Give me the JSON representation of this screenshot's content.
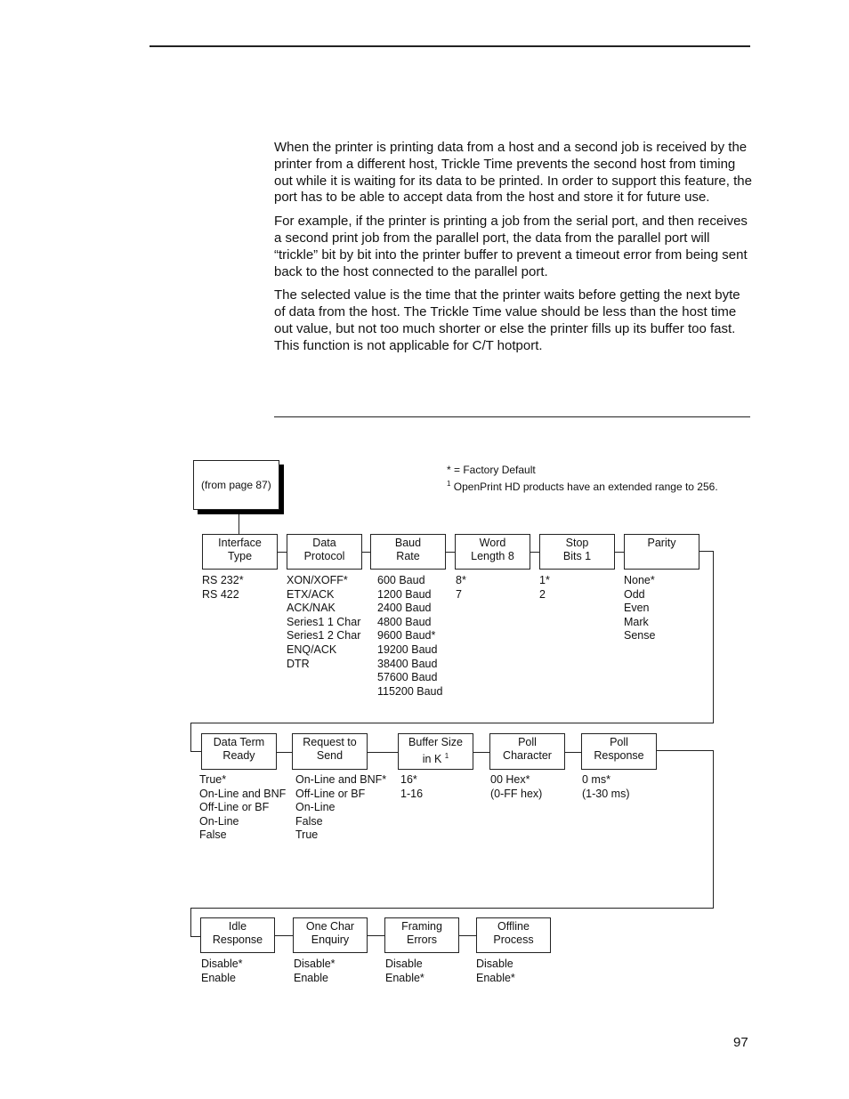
{
  "page": {
    "number": "97",
    "paragraphs": [
      "When the printer is printing data from a host and a second job is received by the printer from a different host, Trickle Time prevents the second host from timing out while it is waiting for its data to be printed. In order to support this feature, the port has to be able to accept data from the host and store it for future use.",
      "For example, if the printer is printing a job from the serial port, and then receives a second print job from the parallel port, the data from the parallel port will “trickle” bit by bit into the printer buffer to prevent a timeout error from being sent back to the host connected to the parallel port.",
      "The selected value is the time that the printer waits before getting the next byte of data from the host. The Trickle Time value should be less than the host time out value, but not too much shorter or else the printer fills up its buffer too fast. This function is not applicable for C/T hotport."
    ]
  },
  "diagram": {
    "from_box": "(from page 87)",
    "legend": {
      "default_note": "* = Factory Default",
      "footnote_mark": "1",
      "footnote_text": "OpenPrint HD products have an extended range to 256."
    },
    "row1": [
      {
        "line1": "Interface",
        "line2": "Type",
        "options": [
          "RS 232*",
          "RS 422"
        ]
      },
      {
        "line1": "Data",
        "line2": "Protocol",
        "options": [
          "XON/XOFF*",
          "ETX/ACK",
          "ACK/NAK",
          "Series1 1 Char",
          "Series1 2 Char",
          "ENQ/ACK",
          "DTR"
        ]
      },
      {
        "line1": "Baud",
        "line2": "Rate",
        "options": [
          "600 Baud",
          "1200 Baud",
          "2400 Baud",
          "4800 Baud",
          "9600 Baud*",
          "19200 Baud",
          "38400 Baud",
          "57600 Baud",
          "115200 Baud"
        ]
      },
      {
        "line1": "Word",
        "line2": "Length 8",
        "options": [
          "8*",
          "7"
        ]
      },
      {
        "line1": "Stop",
        "line2": "Bits 1",
        "options": [
          "1*",
          "2"
        ]
      },
      {
        "line1": "Parity",
        "line2": "",
        "options": [
          "None*",
          "Odd",
          "Even",
          "Mark",
          "Sense"
        ]
      }
    ],
    "row2": [
      {
        "line1": "Data Term",
        "line2": "Ready",
        "options": [
          "True*",
          "On-Line and BNF",
          "Off-Line or BF",
          "On-Line",
          "False"
        ]
      },
      {
        "line1": "Request to",
        "line2": "Send",
        "options": [
          "On-Line and BNF*",
          "Off-Line or BF",
          "On-Line",
          "False",
          "True"
        ]
      },
      {
        "line1": "Buffer Size",
        "line2": "in K",
        "sup": "1",
        "options": [
          "16*",
          "1-16"
        ]
      },
      {
        "line1": "Poll",
        "line2": "Character",
        "options": [
          "00 Hex*",
          "(0-FF hex)"
        ]
      },
      {
        "line1": "Poll",
        "line2": "Response",
        "options": [
          "0 ms*",
          "(1-30 ms)"
        ]
      }
    ],
    "row3": [
      {
        "line1": "Idle",
        "line2": "Response",
        "options": [
          "Disable*",
          "Enable"
        ]
      },
      {
        "line1": "One Char",
        "line2": "Enquiry",
        "options": [
          "Disable*",
          "Enable"
        ]
      },
      {
        "line1": "Framing",
        "line2": "Errors",
        "options": [
          "Disable",
          "Enable*"
        ]
      },
      {
        "line1": "Offline",
        "line2": "Process",
        "options": [
          "Disable",
          "Enable*"
        ]
      }
    ]
  }
}
